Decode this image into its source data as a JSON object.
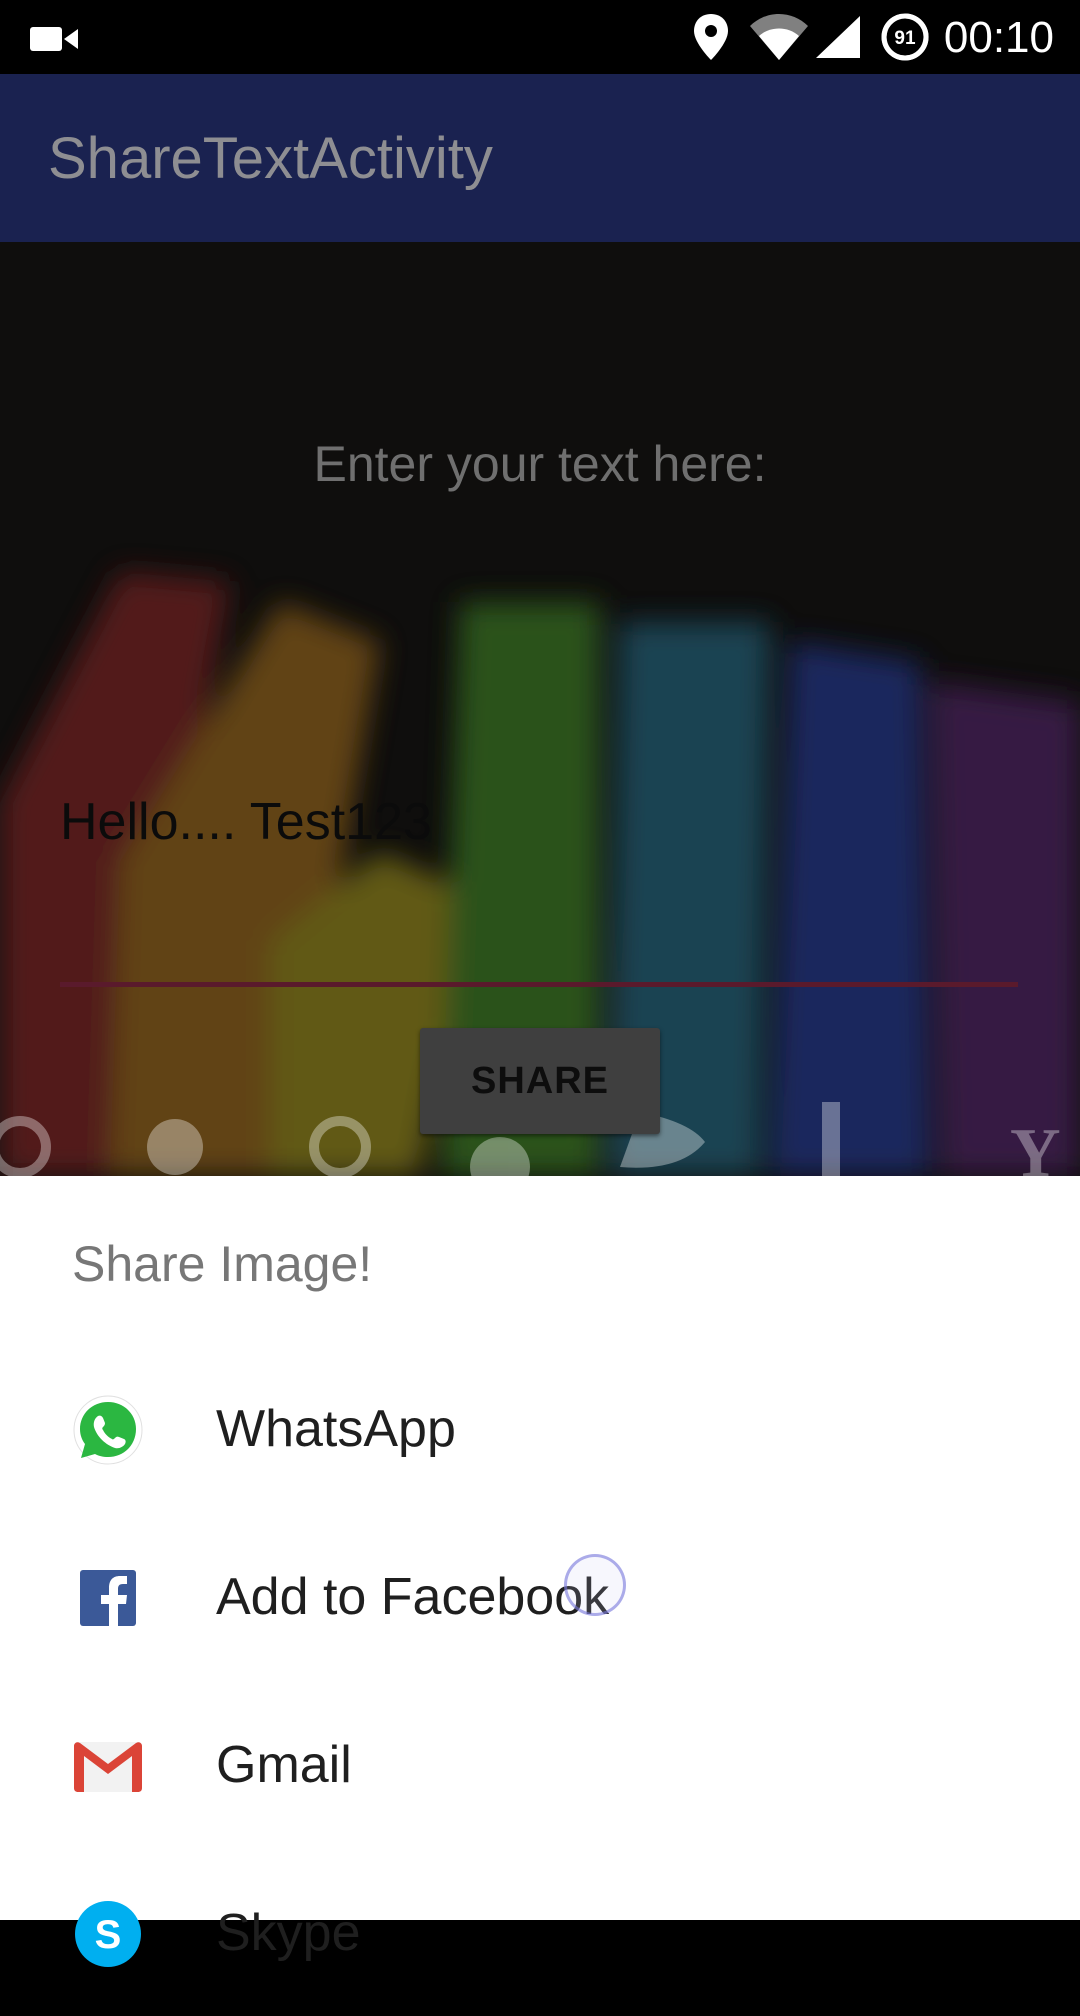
{
  "status_bar": {
    "time": "00:10",
    "battery_level": "91",
    "icons": [
      "video-camera-icon",
      "location-pin-icon",
      "wifi-icon",
      "cell-signal-icon",
      "battery-icon"
    ]
  },
  "app_bar": {
    "title": "ShareTextActivity"
  },
  "main": {
    "prompt_label": "Enter your text here:",
    "input_value": "Hello.... Test123",
    "share_button_label": "SHARE",
    "accent_color": "#5a1a2c",
    "background": "blurred-colored-chalks-with-social-icons"
  },
  "share_sheet": {
    "title": "Share Image!",
    "items": [
      {
        "label": "WhatsApp",
        "icon": "whatsapp-icon",
        "color": "#25d366"
      },
      {
        "label": "Add to Facebook",
        "icon": "facebook-icon",
        "color": "#3b5998"
      },
      {
        "label": "Gmail",
        "icon": "gmail-icon",
        "color": "#db4437"
      },
      {
        "label": "Skype",
        "icon": "skype-icon",
        "color": "#00aff0"
      }
    ]
  }
}
